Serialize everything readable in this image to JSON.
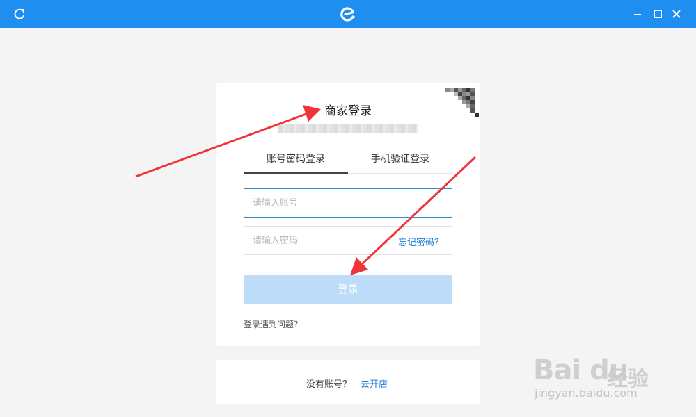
{
  "titlebar": {
    "bg_color": "#1e8ef0",
    "refresh_icon": "refresh-icon",
    "logo_icon": "app-logo-icon",
    "min_icon": "minimize-icon",
    "max_icon": "maximize-icon",
    "close_icon": "close-icon"
  },
  "login": {
    "title": "商家登录",
    "tabs": [
      {
        "label": "账号密码登录",
        "active": true
      },
      {
        "label": "手机验证登录",
        "active": false
      }
    ],
    "account_placeholder": "请输入账号",
    "password_placeholder": "请输入密码",
    "forgot_label": "忘记密码？",
    "login_button": "登录",
    "problem_link": "登录遇到问题？"
  },
  "register": {
    "no_account_text": "没有账号？",
    "open_shop_link": "去开店"
  },
  "watermark": {
    "logo": "Bai du",
    "text": "经验",
    "url": "jingyan.baidu.com"
  },
  "colors": {
    "accent": "#1e7fd6",
    "button_disabled": "#bcdcf8",
    "annotation_arrow": "#f0353a"
  }
}
